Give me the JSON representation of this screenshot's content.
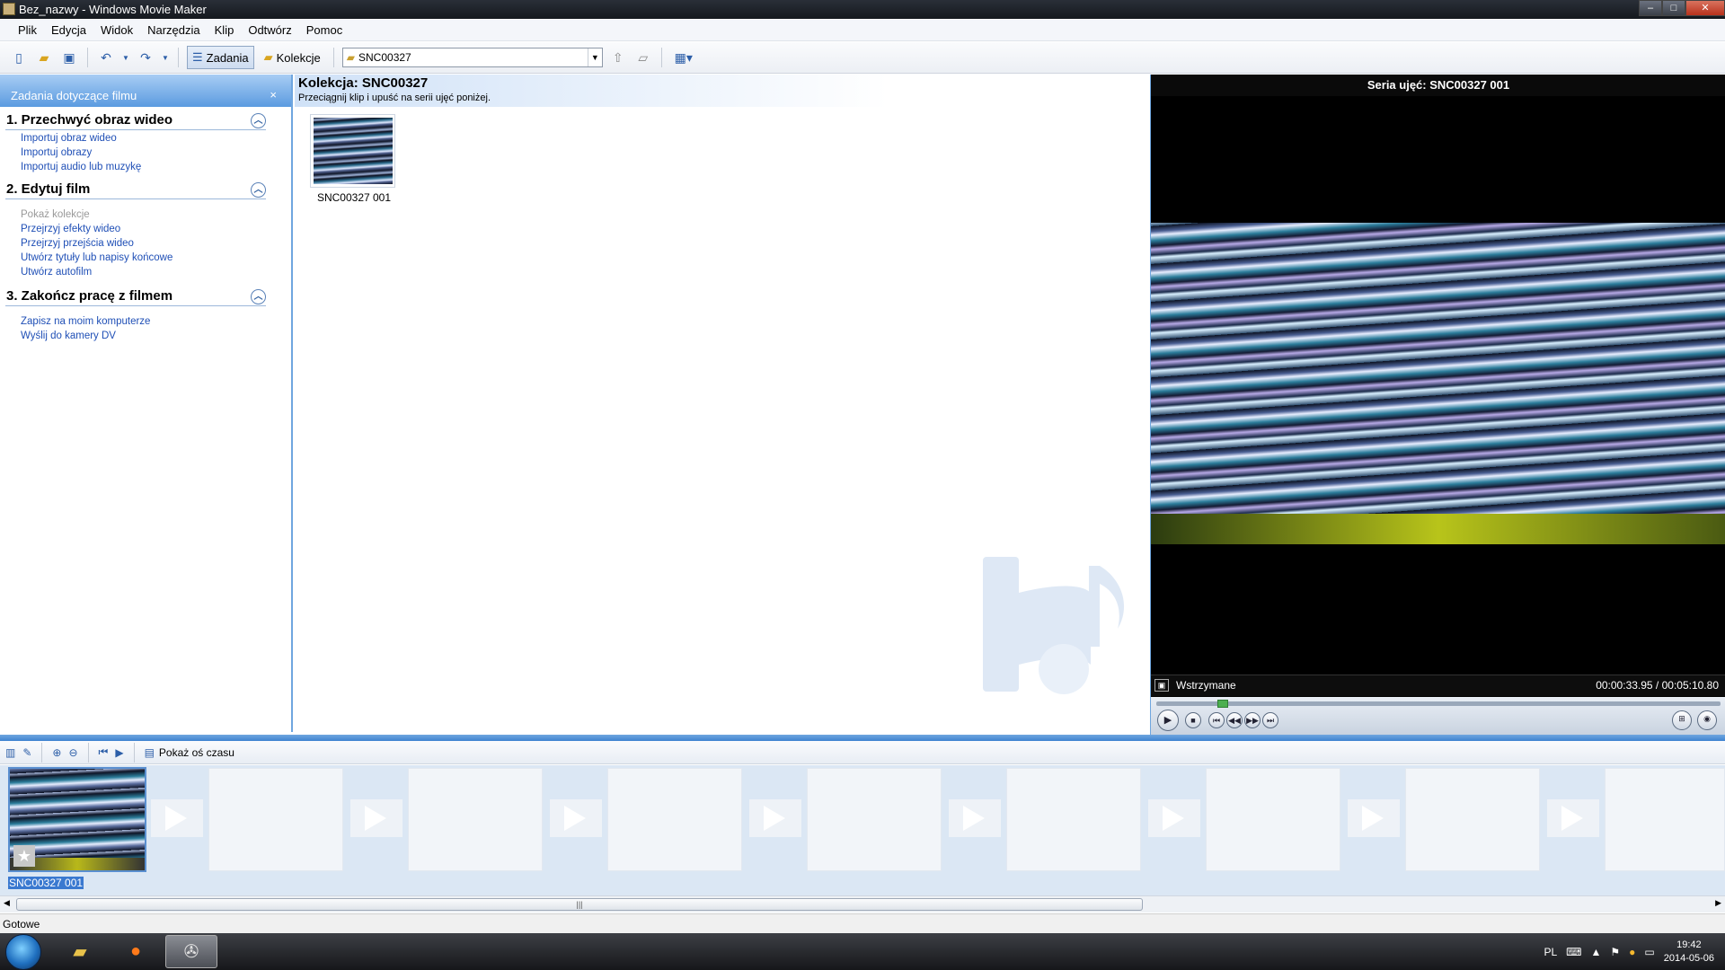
{
  "window": {
    "title": "Bez_nazwy - Windows Movie Maker"
  },
  "menu": [
    "Plik",
    "Edycja",
    "Widok",
    "Narzędzia",
    "Klip",
    "Odtwórz",
    "Pomoc"
  ],
  "toolbar": {
    "tasks_label": "Zadania",
    "collections_label": "Kolekcje",
    "collection_combo": "SNC00327"
  },
  "taskpane": {
    "header": "Zadania dotyczące filmu",
    "close": "×",
    "sections": [
      {
        "title": "1. Przechwyć obraz wideo",
        "links": [
          "Importuj obraz wideo",
          "Importuj obrazy",
          "Importuj audio lub muzykę"
        ]
      },
      {
        "title": "2. Edytuj film",
        "links": [
          "Pokaż kolekcje",
          "Przejrzyj efekty wideo",
          "Przejrzyj przejścia wideo",
          "Utwórz tytuły lub napisy końcowe",
          "Utwórz autofilm"
        ]
      },
      {
        "title": "3. Zakończ pracę z filmem",
        "links": [
          "Zapisz na moim komputerze",
          "Wyślij do kamery DV"
        ]
      }
    ]
  },
  "collection": {
    "title": "Kolekcja: SNC00327",
    "subtitle": "Przeciągnij klip i upuść na serii ujęć poniżej.",
    "clip_label": "SNC00327 001"
  },
  "preview": {
    "title": "Seria ujęć: SNC00327 001",
    "state": "Wstrzymane",
    "time": "00:00:33.95 / 00:05:10.80",
    "progress": 0.11
  },
  "storyboard": {
    "toolbar_label": "Pokaż oś czasu",
    "clip_label": "SNC00327 001"
  },
  "status": {
    "text": "Gotowe"
  },
  "taskbar": {
    "lang": "PL",
    "time": "19:42",
    "date": "2014-05-06"
  }
}
